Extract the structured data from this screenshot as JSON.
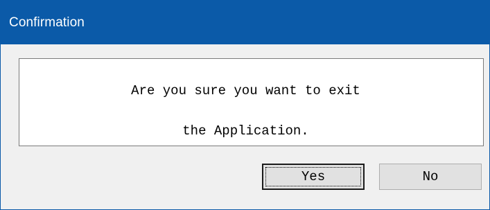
{
  "window": {
    "title": "Confirmation"
  },
  "message": {
    "line1": "Are you sure you want to exit",
    "line2": "the Application."
  },
  "buttons": {
    "yes_label": "Yes",
    "no_label": "No",
    "default": "Yes"
  },
  "colors": {
    "titlebar": "#0b5aa8",
    "title_text": "#ffffff",
    "dialog_background": "#f0f0f0",
    "message_background": "#ffffff",
    "button_face": "#e1e1e1"
  }
}
